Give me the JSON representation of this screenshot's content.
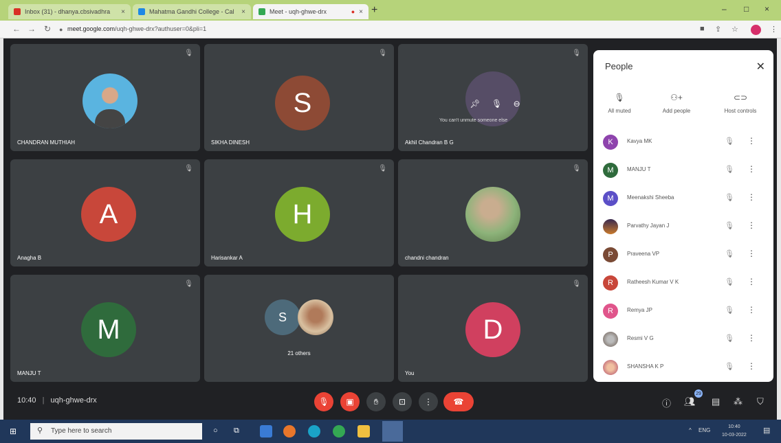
{
  "browser": {
    "tabs": [
      {
        "label": "Inbox (31) - dhanya.cbsivadhra",
        "fav_color": "#d93025",
        "active": false
      },
      {
        "label": "Mahatma Gandhi College - Cal",
        "fav_color": "#1e88e5",
        "active": false
      },
      {
        "label": "Meet - uqh-ghwe-drx",
        "fav_color": "#34a853",
        "active": true
      }
    ],
    "new_tab": "+",
    "url_domain": "meet.google.com",
    "url_path": "/uqh-ghwe-drx?authuser=0&pli=1",
    "window_controls": [
      "–",
      "□",
      "×"
    ]
  },
  "tiles": [
    {
      "name": "CHANDRAN MUTHIAH",
      "kind": "photo",
      "photo_colors": [
        "#5ab4e0",
        "#6b4a3a"
      ]
    },
    {
      "name": "SIKHA DINESH",
      "kind": "letter",
      "letter": "S",
      "color": "#8d4a35"
    },
    {
      "name": "Akhil Chandran B G",
      "kind": "hover",
      "hover_note": "You can't unmute someone else"
    },
    {
      "name": "Anagha B",
      "kind": "letter",
      "letter": "A",
      "color": "#c8473a"
    },
    {
      "name": "Harisankar A",
      "kind": "letter",
      "letter": "H",
      "color": "#7cab2e"
    },
    {
      "name": "chandni chandran",
      "kind": "photo",
      "photo_colors": [
        "#8db37a",
        "#c9ad8f"
      ]
    },
    {
      "name": "MANJU T",
      "kind": "letter",
      "letter": "M",
      "color": "#2f6b3c"
    },
    {
      "name": "",
      "kind": "group",
      "group_letter": "S",
      "group_label": "21 others"
    },
    {
      "name": "You",
      "kind": "letter",
      "letter": "D",
      "color": "#d0405f"
    }
  ],
  "people_panel": {
    "title": "People",
    "close_icon": "close-icon",
    "actions": [
      {
        "label": "All muted",
        "icon": "mic-off-icon"
      },
      {
        "label": "Add people",
        "icon": "add-person-icon"
      },
      {
        "label": "Host controls",
        "icon": "toggle-icon"
      }
    ],
    "participants": [
      {
        "name": "Kavya MK",
        "initial": "K",
        "color": "#8e44ad"
      },
      {
        "name": "MANJU T",
        "initial": "M",
        "color": "#2f6b3c"
      },
      {
        "name": "Meenakshi Sheeba",
        "initial": "M",
        "color": "#5b4fc7"
      },
      {
        "name": "Parvathy Jayan J",
        "initial": "",
        "color": "#c97a2c"
      },
      {
        "name": "Praveena VP",
        "initial": "P",
        "color": "#7a4a35"
      },
      {
        "name": "Ratheesh Kumar V K",
        "initial": "R",
        "color": "#c8473a"
      },
      {
        "name": "Remya JP",
        "initial": "R",
        "color": "#e0558b"
      },
      {
        "name": "Resmi V G",
        "initial": "",
        "color": "#6a5a50"
      },
      {
        "name": "SHANSHA K P",
        "initial": "",
        "color": "#b04a6a"
      }
    ]
  },
  "bottom_bar": {
    "time": "10:40",
    "meeting_code": "uqh-ghwe-drx",
    "separator": "|",
    "participant_count": "29"
  },
  "taskbar": {
    "search_placeholder": "Type here to search",
    "lang": "ENG",
    "time": "10:40",
    "date": "10-03-2022"
  }
}
